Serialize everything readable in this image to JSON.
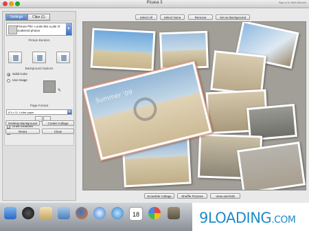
{
  "window": {
    "title": "Picasa 3",
    "titlebar_link": "Sign in to Web Albums"
  },
  "sidebar": {
    "tabs": [
      {
        "label": "Settings",
        "active": true
      },
      {
        "label": "Clips (1)",
        "active": false
      }
    ],
    "collage_style": "Picture Pile: Looks like a pile of scattered photos",
    "picture_borders_label": "Picture Borders",
    "background_options_label": "Background Options",
    "background_options": [
      {
        "label": "Solid Color",
        "selected": true
      },
      {
        "label": "Use Image",
        "selected": false
      }
    ],
    "page_format_label": "Page Format",
    "page_format_value": "8.5 x 11: Letter paper",
    "checkboxes": [
      {
        "label": "Draw Shadows",
        "checked": true
      },
      {
        "label": "Show Captions",
        "checked": true
      }
    ],
    "buttons": {
      "desktop_background": "Desktop Background",
      "create_collage": "Create Collage",
      "reset": "Reset",
      "close": "Close"
    }
  },
  "toolbar": {
    "select_all": "Select All",
    "select_none": "Select None",
    "remove": "Remove",
    "set_as_background": "Set as Background"
  },
  "bottom_bar": {
    "scramble_collage": "Scramble Collage",
    "shuffle_pictures": "Shuffle Pictures",
    "view_and_edit": "View and Edit"
  },
  "canvas": {
    "background_color": "#a29f98",
    "selected_photo_caption": "Summer '09"
  },
  "dock": {
    "icons": [
      "finder-icon",
      "dashboard-icon",
      "mail-icon",
      "photo-app-icon",
      "firefox-icon",
      "safari-icon",
      "itunes-icon",
      "ical-icon",
      "picasa-icon",
      "preview-icon"
    ],
    "calendar_day": "18"
  },
  "watermark": {
    "text_large": "9LOADING",
    "text_small": ".COM"
  }
}
